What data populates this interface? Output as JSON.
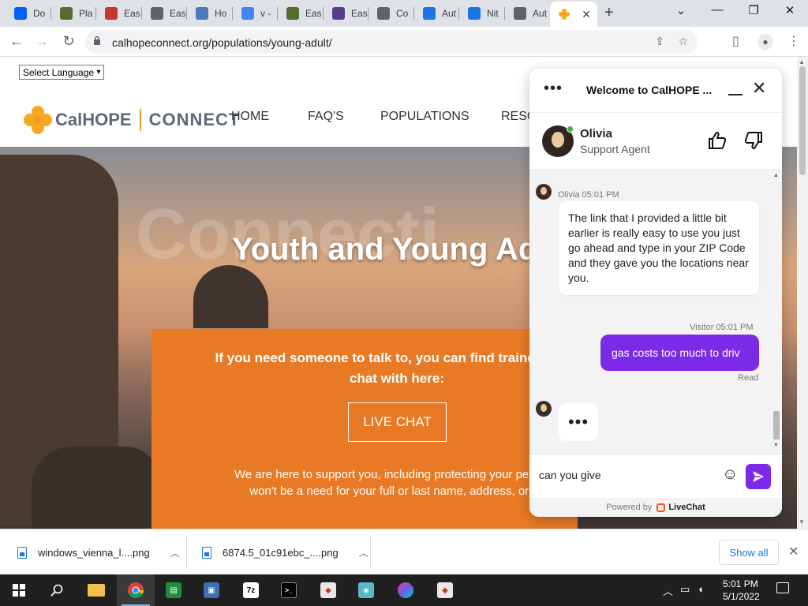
{
  "browser": {
    "tabs": [
      {
        "title": "Do",
        "icon": "dropbox-icon",
        "color": "#0061ff"
      },
      {
        "title": "Pla",
        "icon": "puzzle-icon",
        "color": "#556b2f"
      },
      {
        "title": "Eas",
        "icon": "lips-icon",
        "color": "#c0392b"
      },
      {
        "title": "Eas",
        "icon": "globe-icon",
        "color": "#5f6368"
      },
      {
        "title": "Ho",
        "icon": "image-icon",
        "color": "#4a7ab7"
      },
      {
        "title": "v -",
        "icon": "google-icon",
        "color": "#4285f4"
      },
      {
        "title": "Eas",
        "icon": "puzzle-icon",
        "color": "#556b2f"
      },
      {
        "title": "Eas",
        "icon": "app-icon",
        "color": "#5a3d8a"
      },
      {
        "title": "Co",
        "icon": "globe-icon",
        "color": "#5f6368"
      },
      {
        "title": "Aut",
        "icon": "target-icon",
        "color": "#1a73e8"
      },
      {
        "title": "Nit",
        "icon": "flame-icon",
        "color": "#1a73e8"
      },
      {
        "title": "Aut",
        "icon": "globe-icon",
        "color": "#5f6368"
      }
    ],
    "active_tab_icon": "calhope-flower-icon",
    "url": "calhopeconnect.org/populations/young-adult/"
  },
  "site": {
    "language_select": "Select Language",
    "brand_calhope": "CalHOPE",
    "brand_connect": "CONNECT",
    "nav": [
      "HOME",
      "FAQ'S",
      "POPULATIONS",
      "RESO"
    ],
    "hero_ghost": "Connecti",
    "hero_title": "Youth and Young Adu",
    "card_line1": "If you need someone to talk to, you can find trained supp",
    "card_line2": "chat with here:",
    "live_chat_button": "LIVE CHAT",
    "card_support1": "We are here to support you, including protecting your personal in",
    "card_support2": "won't be a need for your full or last name, address, or phon"
  },
  "chat": {
    "header_title": "Welcome to CalHOPE ...",
    "agent_name": "Olivia",
    "agent_role": "Support Agent",
    "agent_meta": "Olivia 05:01 PM",
    "agent_message": "The link that I provided a little bit earlier is really easy to use you just go ahead and type in your ZIP Code and they gave you the locations near you.",
    "visitor_meta": "Visitor 05:01 PM",
    "visitor_message": "gas costs too much to driv",
    "read_status": "Read",
    "typing": "•••",
    "composer_value": "can you give",
    "powered_by": "Powered by",
    "powered_brand": "LiveChat",
    "accent": "#7c2ae8"
  },
  "downloads": {
    "items": [
      "windows_vienna_l....png",
      "6874.5_01c91ebc_....png"
    ],
    "show_all": "Show all"
  },
  "taskbar": {
    "time": "5:01 PM",
    "date": "5/1/2022"
  }
}
